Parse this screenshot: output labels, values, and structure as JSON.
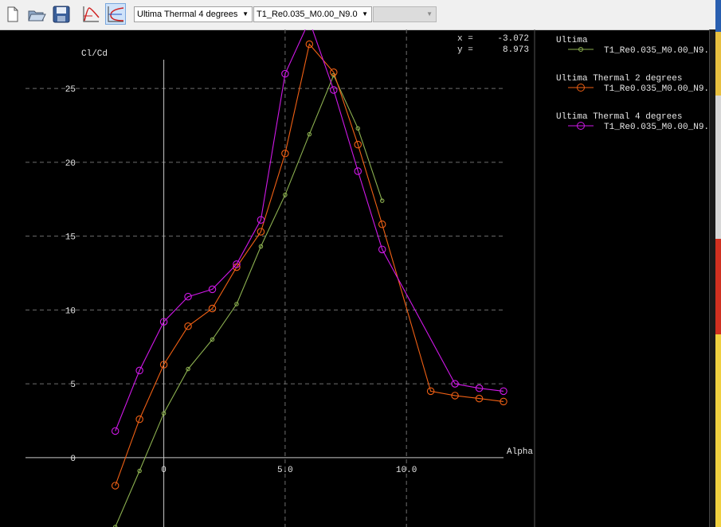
{
  "toolbar": {
    "foil_select": {
      "value": "Ultima Thermal 4 degrees"
    },
    "polar_select": {
      "value": "T1_Re0.035_M0.00_N9.0"
    },
    "opp_select": {
      "value": ""
    }
  },
  "readout": {
    "x_label": "x =",
    "x_value": "-3.072",
    "y_label": "y =",
    "y_value": "8.973"
  },
  "legend": [
    {
      "foil": "Ultima",
      "polar": "T1_Re0.035_M0.00_N9."
    },
    {
      "foil": "Ultima Thermal 2 degrees",
      "polar": "T1_Re0.035_M0.00_N9."
    },
    {
      "foil": "Ultima Thermal 4 degrees",
      "polar": "T1_Re0.035_M0.00_N9."
    }
  ],
  "colors": {
    "background": "#000000",
    "grid": "#6e6e6e",
    "axis": "#c8c8c8",
    "text": "#e6e6e6",
    "ultima": "#8cb050",
    "thermal2": "#f06014",
    "thermal4": "#d018e8"
  },
  "chart_data": {
    "type": "line",
    "ylabel": "Cl/Cd",
    "xlabel": "Alpha",
    "xlim": [
      -5.7,
      14.0
    ],
    "ylim": [
      -4.7,
      29.0
    ],
    "x_ticks": [
      {
        "value": 0,
        "label": "0"
      },
      {
        "value": 5,
        "label": "5.0"
      },
      {
        "value": 10,
        "label": "10.0"
      }
    ],
    "y_ticks": [
      {
        "value": 0,
        "label": "0"
      },
      {
        "value": 5,
        "label": "5"
      },
      {
        "value": 10,
        "label": "10"
      },
      {
        "value": 15,
        "label": "15"
      },
      {
        "value": 20,
        "label": "20"
      },
      {
        "value": 25,
        "label": "25"
      }
    ],
    "grid": true,
    "legend_position": "right",
    "series": [
      {
        "name": "T1_Re0.035_M0.00_N9.",
        "color": "#8cb050",
        "marker": "dot",
        "x": [
          -2.0,
          -1.0,
          0.0,
          1.0,
          2.0,
          3.0,
          4.0,
          5.0,
          6.0,
          7.0,
          8.0,
          9.0
        ],
        "y": [
          -4.7,
          -0.9,
          3.0,
          6.0,
          8.0,
          10.4,
          14.3,
          17.8,
          21.9,
          25.9,
          22.3,
          17.4
        ]
      },
      {
        "name": "T1_Re0.035_M0.00_N9.",
        "color": "#f06014",
        "marker": "circle",
        "x": [
          -2.0,
          -1.0,
          0.0,
          1.0,
          2.0,
          3.0,
          4.0,
          5.0,
          6.0,
          7.0,
          8.0,
          9.0,
          11.0,
          12.0,
          13.0,
          14.0
        ],
        "y": [
          -1.9,
          2.6,
          6.3,
          8.9,
          10.1,
          12.9,
          15.3,
          20.6,
          28.0,
          26.1,
          21.2,
          15.8,
          4.5,
          4.2,
          4.0,
          3.8
        ]
      },
      {
        "name": "T1_Re0.035_M0.00_N9.",
        "color": "#d018e8",
        "marker": "circle",
        "x": [
          -2.0,
          -1.0,
          0.0,
          1.0,
          2.0,
          3.0,
          4.0,
          5.0,
          6.0,
          7.0,
          8.0,
          9.0,
          12.0,
          13.0,
          14.0
        ],
        "y": [
          1.8,
          5.9,
          9.2,
          10.9,
          11.4,
          13.1,
          16.1,
          26.0,
          29.6,
          24.9,
          19.4,
          14.1,
          5.0,
          4.7,
          4.5
        ]
      }
    ]
  }
}
